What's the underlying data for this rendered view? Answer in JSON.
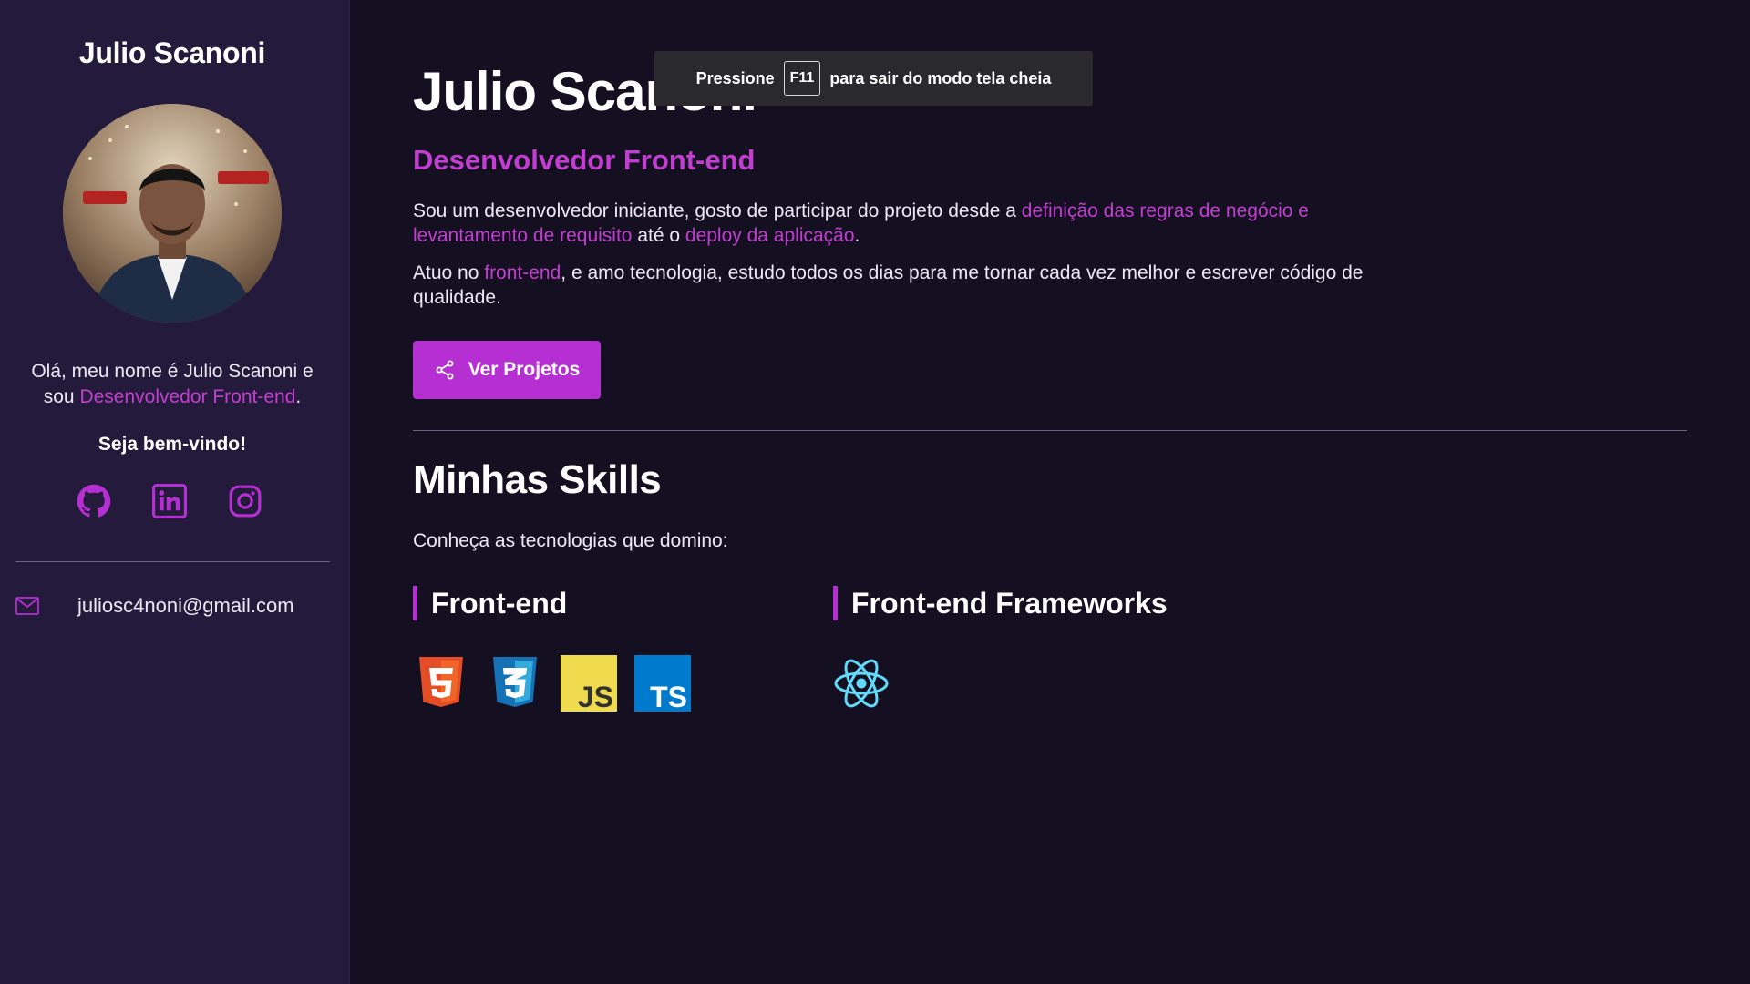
{
  "sidebar": {
    "name": "Julio Scanoni",
    "intro_before": "Olá, meu nome é Julio Scanoni e sou ",
    "intro_role": "Desenvolvedor Front-end",
    "intro_after": ".",
    "welcome": "Seja bem-vindo!",
    "socials": [
      {
        "icon": "github-icon"
      },
      {
        "icon": "linkedin-icon"
      },
      {
        "icon": "instagram-icon"
      }
    ],
    "email": "juliosc4noni@gmail.com"
  },
  "main": {
    "title": "Julio Scanoni",
    "subtitle": "Desenvolvedor Front-end",
    "p1": {
      "t1": "Sou um desenvolvedor iniciante, gosto de participar do projeto desde a ",
      "h1": "definição das regras de negócio e levantamento de requisito",
      "t2": " até o ",
      "h2": "deploy da aplicação",
      "t3": "."
    },
    "p2": {
      "t1": "Atuo no ",
      "h1": "front-end",
      "t2": ", e amo tecnologia, estudo todos os dias para me tornar cada vez melhor e escrever código de qualidade."
    },
    "cta_label": "Ver Projetos",
    "skills_title": "Minhas Skills",
    "skills_intro": "Conheça as tecnologias que domino:",
    "groups": [
      {
        "title": "Front-end",
        "icons": [
          "html5-icon",
          "css3-icon",
          "javascript-icon",
          "typescript-icon"
        ]
      },
      {
        "title": "Front-end Frameworks",
        "icons": [
          "react-icon"
        ]
      }
    ]
  },
  "fullscreen_notice": {
    "before": "Pressione",
    "key": "F11",
    "after": "para sair do modo tela cheia"
  },
  "colors": {
    "accent": "#b62fd2",
    "sidebar_bg": "#241b3c",
    "page_bg": "#151021"
  }
}
